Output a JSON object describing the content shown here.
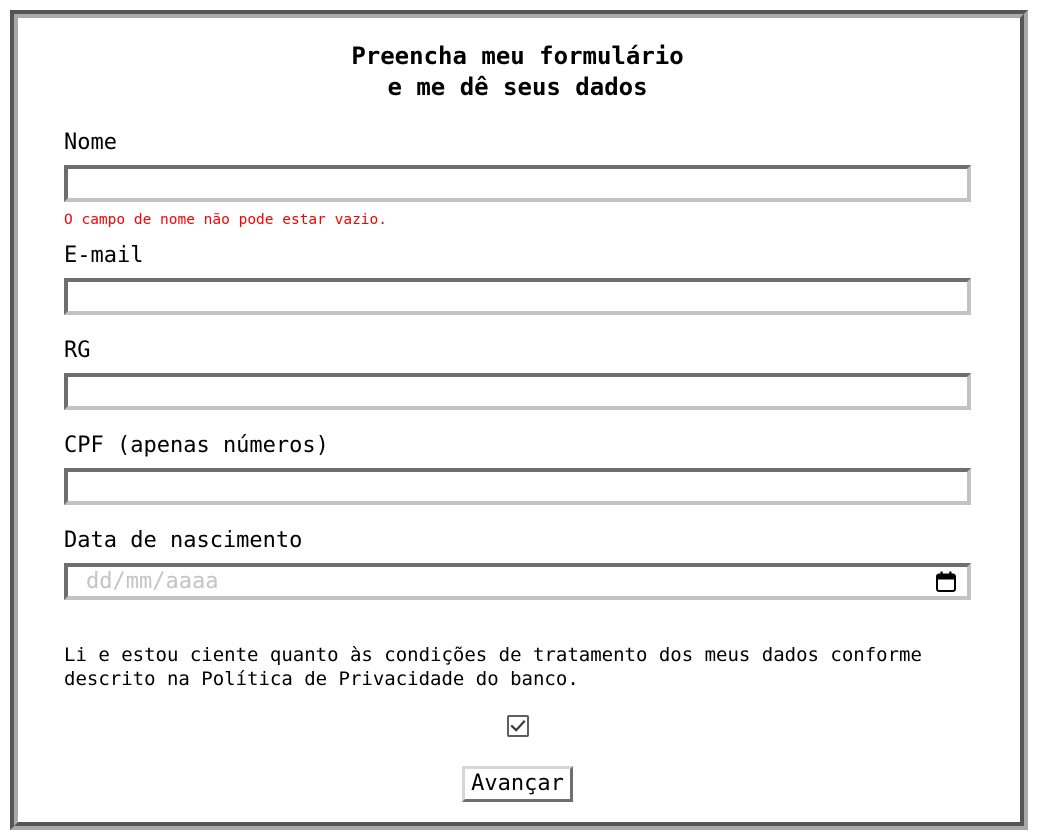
{
  "form": {
    "title_line1": "Preencha meu formulário",
    "title_line2": "e me dê seus dados",
    "fields": [
      {
        "label": "Nome",
        "value": "",
        "error": "O campo de nome não pode estar vazio."
      },
      {
        "label": "E-mail",
        "value": ""
      },
      {
        "label": "RG",
        "value": ""
      },
      {
        "label": "CPF (apenas números)",
        "value": ""
      },
      {
        "label": "Data de nascimento",
        "value": "",
        "placeholder": "dd/mm/aaaa"
      }
    ],
    "consent_text": "Li e estou ciente quanto às condições de tratamento dos meus dados conforme descrito na Política de Privacidade do banco.",
    "consent_checked": true,
    "submit_label": "Avançar"
  },
  "icons": {
    "date_picker": "calendar-icon",
    "consent_mark": "checkmark-icon"
  },
  "colors": {
    "error": "#ff0000",
    "placeholder": "#c4c4c4",
    "text": "#000000"
  }
}
